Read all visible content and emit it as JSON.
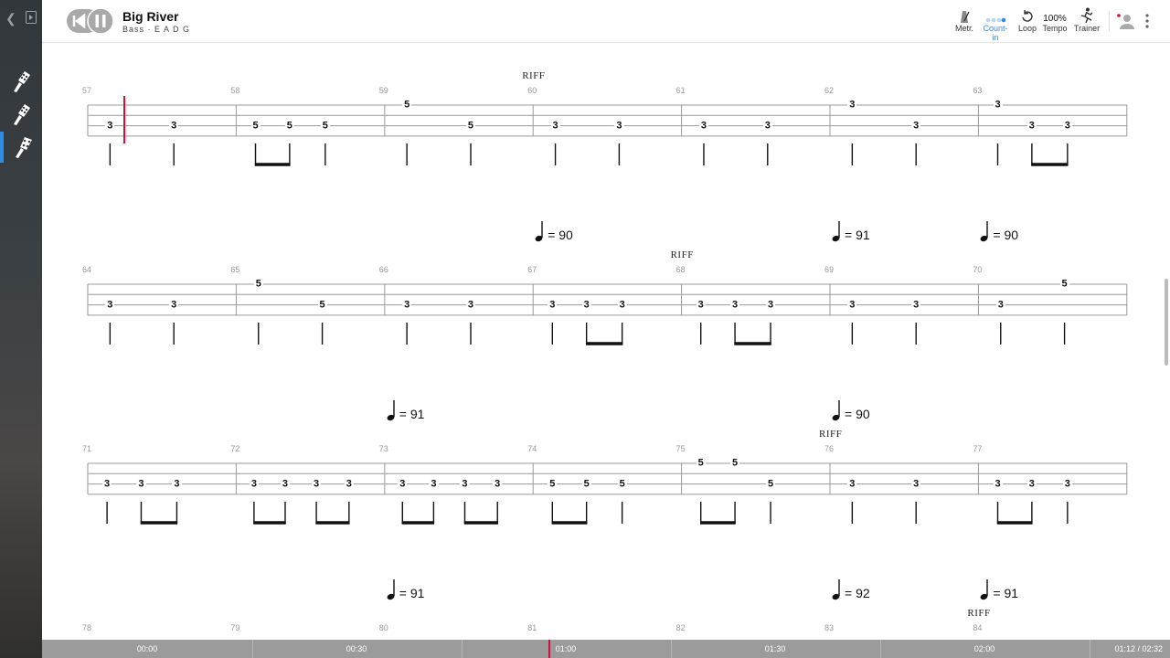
{
  "song": {
    "title": "Big River",
    "subtitle": "Bass · E A D G"
  },
  "toolbar": {
    "metronome": "Metr.",
    "count_in": "Count-in",
    "loop": "Loop",
    "tempo_value": "100%",
    "tempo": "Tempo",
    "trainer": "Trainer"
  },
  "colors": {
    "accent": "#2f8ce0",
    "cursor": "#d0103a"
  },
  "score": {
    "systems": [
      {
        "measures": [
          {
            "number": "57",
            "notes": [
              [
                "3",
                2
              ],
              [
                "3",
                2
              ]
            ],
            "beams": []
          },
          {
            "number": "58",
            "notes": [
              [
                "5",
                2
              ],
              [
                "5",
                2
              ],
              [
                "5",
                2
              ]
            ],
            "beams": [
              [
                0,
                1
              ]
            ]
          },
          {
            "number": "59",
            "notes": [
              [
                "5",
                0
              ],
              [
                "5",
                2
              ]
            ],
            "beams": []
          },
          {
            "number": "60",
            "notes": [
              [
                "3",
                2
              ],
              [
                "3",
                2
              ]
            ],
            "beams": []
          },
          {
            "number": "61",
            "notes": [
              [
                "3",
                2
              ],
              [
                "3",
                2
              ]
            ],
            "beams": []
          },
          {
            "number": "62",
            "notes": [
              [
                "3",
                0
              ],
              [
                "3",
                2
              ]
            ],
            "beams": []
          },
          {
            "number": "63",
            "notes": [
              [
                "3",
                0
              ],
              [
                "3",
                2
              ],
              [
                "3",
                2
              ]
            ],
            "beams": [
              [
                1,
                2
              ]
            ]
          }
        ],
        "riffs": [
          {
            "text": "RIFF",
            "measure": 3
          }
        ],
        "tempos": []
      },
      {
        "measures": [
          {
            "number": "64",
            "notes": [
              [
                "3",
                2
              ],
              [
                "3",
                2
              ]
            ],
            "beams": []
          },
          {
            "number": "65",
            "notes": [
              [
                "5",
                0
              ],
              [
                "5",
                2
              ]
            ],
            "beams": []
          },
          {
            "number": "66",
            "notes": [
              [
                "3",
                2
              ],
              [
                "3",
                2
              ]
            ],
            "beams": []
          },
          {
            "number": "67",
            "notes": [
              [
                "3",
                2
              ],
              [
                "3",
                2
              ],
              [
                "3",
                2
              ]
            ],
            "beams": [
              [
                1,
                2
              ]
            ]
          },
          {
            "number": "68",
            "notes": [
              [
                "3",
                2
              ],
              [
                "3",
                2
              ],
              [
                "3",
                2
              ]
            ],
            "beams": [
              [
                1,
                2
              ]
            ]
          },
          {
            "number": "69",
            "notes": [
              [
                "3",
                2
              ],
              [
                "3",
                2
              ]
            ],
            "beams": []
          },
          {
            "number": "70",
            "notes": [
              [
                "3",
                2
              ],
              [
                "5",
                0
              ]
            ],
            "beams": []
          }
        ],
        "riffs": [
          {
            "text": "RIFF",
            "measure": 4
          }
        ],
        "tempos": [
          {
            "measure": 3,
            "value": "= 90"
          },
          {
            "measure": 5,
            "value": "= 91"
          },
          {
            "measure": 6,
            "value": "= 90"
          }
        ]
      },
      {
        "measures": [
          {
            "number": "71",
            "notes": [
              [
                "3",
                2
              ],
              [
                "3",
                2
              ],
              [
                "3",
                2
              ]
            ],
            "beams": [
              [
                1,
                2
              ]
            ]
          },
          {
            "number": "72",
            "notes": [
              [
                "3",
                2
              ],
              [
                "3",
                2
              ],
              [
                "3",
                2
              ],
              [
                "3",
                2
              ]
            ],
            "beams": [
              [
                0,
                1
              ],
              [
                2,
                3
              ]
            ]
          },
          {
            "number": "73",
            "notes": [
              [
                "3",
                2
              ],
              [
                "3",
                2
              ],
              [
                "3",
                2
              ],
              [
                "3",
                2
              ]
            ],
            "beams": [
              [
                0,
                1
              ],
              [
                2,
                3
              ]
            ]
          },
          {
            "number": "74",
            "notes": [
              [
                "5",
                2
              ],
              [
                "5",
                2
              ],
              [
                "5",
                2
              ]
            ],
            "beams": [
              [
                0,
                1
              ]
            ]
          },
          {
            "number": "75",
            "notes": [
              [
                "5",
                0
              ],
              [
                "5",
                0
              ],
              [
                "5",
                2
              ]
            ],
            "beams": [
              [
                0,
                1
              ]
            ]
          },
          {
            "number": "76",
            "notes": [
              [
                "3",
                2
              ],
              [
                "3",
                2
              ]
            ],
            "beams": []
          },
          {
            "number": "77",
            "notes": [
              [
                "3",
                2
              ],
              [
                "3",
                2
              ],
              [
                "3",
                2
              ]
            ],
            "beams": [
              [
                0,
                1
              ]
            ]
          }
        ],
        "riffs": [
          {
            "text": "RIFF",
            "measure": 5
          }
        ],
        "tempos": [
          {
            "measure": 2,
            "value": "= 91"
          },
          {
            "measure": 5,
            "value": "= 90"
          }
        ]
      },
      {
        "measures": [
          {
            "number": "78",
            "notes": [],
            "beams": []
          },
          {
            "number": "79",
            "notes": [],
            "beams": []
          },
          {
            "number": "80",
            "notes": [],
            "beams": []
          },
          {
            "number": "81",
            "notes": [],
            "beams": []
          },
          {
            "number": "82",
            "notes": [],
            "beams": []
          },
          {
            "number": "83",
            "notes": [],
            "beams": []
          },
          {
            "number": "84",
            "notes": [],
            "beams": []
          }
        ],
        "riffs": [
          {
            "text": "RIFF",
            "measure": 6
          }
        ],
        "tempos": [
          {
            "measure": 2,
            "value": "= 91"
          },
          {
            "measure": 5,
            "value": "= 92"
          },
          {
            "measure": 6,
            "value": "= 91"
          }
        ]
      }
    ]
  },
  "timeline": {
    "labels": [
      "00:00",
      "00:30",
      "01:00",
      "01:30",
      "02:00"
    ],
    "position": "01:12 / 02:32"
  }
}
